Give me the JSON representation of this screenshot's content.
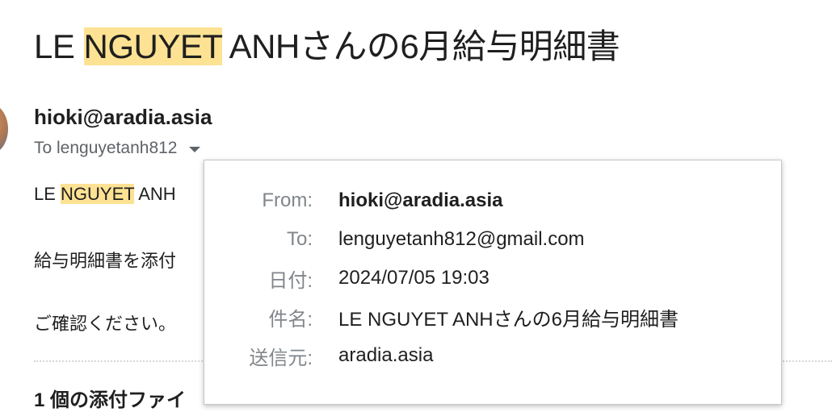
{
  "email": {
    "subject": {
      "pre": "LE ",
      "highlight": "NGUYET",
      "post": " ANHさんの6月給与明細書"
    },
    "sender": "hioki@aradia.asia",
    "to_label": "To lenguyetanh812",
    "body": {
      "line1_pre": "LE ",
      "line1_highlight": "NGUYET",
      "line1_post": " ANH",
      "line2": "給与明細書を添付",
      "line3": "ご確認ください。"
    },
    "attachments_title": "1 個の添付ファイ"
  },
  "details_popup": {
    "rows": [
      {
        "label": "From:",
        "value": "hioki@aradia.asia"
      },
      {
        "label": "To:",
        "value": "lenguyetanh812@gmail.com"
      },
      {
        "label": "日付:",
        "value": "2024/07/05 19:03"
      },
      {
        "label": "件名:",
        "value": "LE NGUYET ANHさんの6月給与明細書"
      },
      {
        "label": "送信元:",
        "value": "aradia.asia"
      }
    ]
  },
  "colors": {
    "highlight": "#fde293",
    "text": "#1f1f1f",
    "secondary_text": "#5f6368",
    "label_text": "#80868b"
  },
  "icons": {
    "recipients_toggle": "caret-down-icon"
  }
}
